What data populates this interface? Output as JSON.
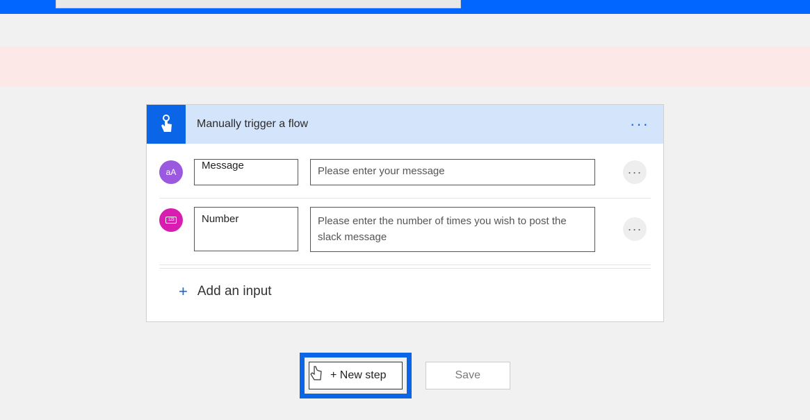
{
  "trigger": {
    "title": "Manually trigger a flow",
    "inputs": [
      {
        "badge_color": "#9b59e0",
        "badge_glyph": "aA",
        "name": "Message",
        "description": "Please enter your message"
      },
      {
        "badge_color": "#d81eb0",
        "badge_glyph": "123",
        "name": "Number",
        "description": "Please enter the number of times you wish to post the slack message"
      }
    ],
    "add_input_label": "Add an input"
  },
  "footer": {
    "new_step_label": "+ New step",
    "save_label": "Save"
  }
}
